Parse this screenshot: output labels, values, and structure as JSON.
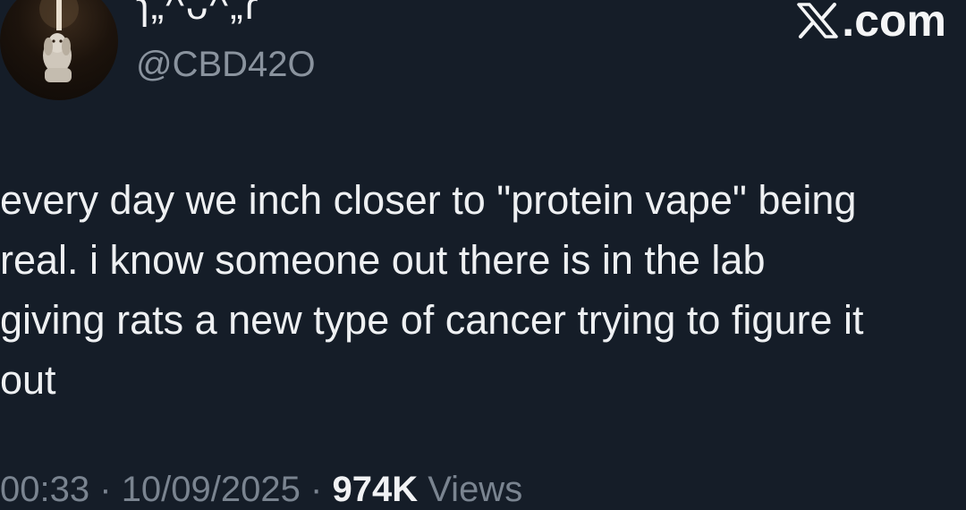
{
  "author": {
    "display_name": "ɿ„^ᴗ^„ɾ",
    "handle": "@CBD42O"
  },
  "brand": {
    "label": ".com",
    "icon": "x-logo-icon"
  },
  "tweet": {
    "lines": [
      "every day we inch closer to \"protein vape\" being",
      "real. i know someone out there is in the lab",
      "giving rats a new type of cancer trying to figure it",
      "out"
    ]
  },
  "meta": {
    "time": "00:33",
    "separator": "·",
    "date": "10/09/2025",
    "views_count": "974K",
    "views_label": "Views"
  },
  "colors": {
    "background": "#151d28",
    "text": "#eef0f2",
    "muted": "#8a939e"
  }
}
